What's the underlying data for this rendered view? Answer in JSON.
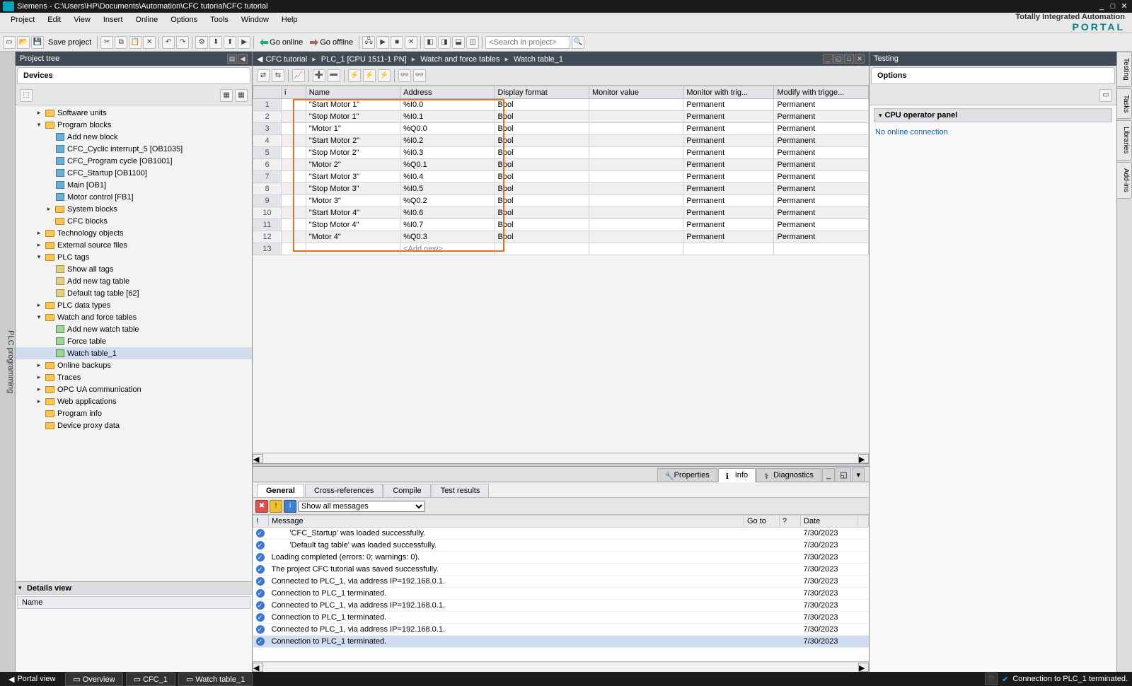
{
  "title": "Siemens  -  C:\\Users\\HP\\Documents\\Automation\\CFC tutorial\\CFC tutorial",
  "brand_line1": "Totally Integrated Automation",
  "brand_line2": "PORTAL",
  "mainmenu": [
    "Project",
    "Edit",
    "View",
    "Insert",
    "Online",
    "Options",
    "Tools",
    "Window",
    "Help"
  ],
  "toolbar": {
    "save_label": "Save project",
    "go_online": "Go online",
    "go_offline": "Go offline",
    "search_placeholder": "<Search in project>"
  },
  "left_strip": "PLC programming",
  "project_tree": {
    "title": "Project tree",
    "devices_tab": "Devices",
    "nodes": [
      {
        "depth": 2,
        "exp": ">",
        "icon": "folder",
        "label": "Software units"
      },
      {
        "depth": 2,
        "exp": "v",
        "icon": "folder",
        "label": "Program blocks"
      },
      {
        "depth": 3,
        "exp": "",
        "icon": "block",
        "label": "Add new block"
      },
      {
        "depth": 3,
        "exp": "",
        "icon": "block",
        "label": "CFC_Cyclic interrupt_5 [OB1035]"
      },
      {
        "depth": 3,
        "exp": "",
        "icon": "block",
        "label": "CFC_Program cycle [OB1001]"
      },
      {
        "depth": 3,
        "exp": "",
        "icon": "block",
        "label": "CFC_Startup [OB1100]"
      },
      {
        "depth": 3,
        "exp": "",
        "icon": "block",
        "label": "Main [OB1]"
      },
      {
        "depth": 3,
        "exp": "",
        "icon": "block",
        "label": "Motor control [FB1]"
      },
      {
        "depth": 3,
        "exp": ">",
        "icon": "folder",
        "label": "System blocks"
      },
      {
        "depth": 3,
        "exp": "",
        "icon": "folder",
        "label": "CFC blocks"
      },
      {
        "depth": 2,
        "exp": ">",
        "icon": "folder",
        "label": "Technology objects"
      },
      {
        "depth": 2,
        "exp": ">",
        "icon": "folder",
        "label": "External source files"
      },
      {
        "depth": 2,
        "exp": "v",
        "icon": "folder",
        "label": "PLC tags"
      },
      {
        "depth": 3,
        "exp": "",
        "icon": "tag",
        "label": "Show all tags"
      },
      {
        "depth": 3,
        "exp": "",
        "icon": "tag",
        "label": "Add new tag table"
      },
      {
        "depth": 3,
        "exp": "",
        "icon": "tag",
        "label": "Default tag table [62]"
      },
      {
        "depth": 2,
        "exp": ">",
        "icon": "folder",
        "label": "PLC data types"
      },
      {
        "depth": 2,
        "exp": "v",
        "icon": "folder",
        "label": "Watch and force tables"
      },
      {
        "depth": 3,
        "exp": "",
        "icon": "table",
        "label": "Add new watch table"
      },
      {
        "depth": 3,
        "exp": "",
        "icon": "table",
        "label": "Force table"
      },
      {
        "depth": 3,
        "exp": "",
        "icon": "table",
        "label": "Watch table_1",
        "selected": true
      },
      {
        "depth": 2,
        "exp": ">",
        "icon": "folder",
        "label": "Online backups"
      },
      {
        "depth": 2,
        "exp": ">",
        "icon": "folder",
        "label": "Traces"
      },
      {
        "depth": 2,
        "exp": ">",
        "icon": "folder",
        "label": "OPC UA communication"
      },
      {
        "depth": 2,
        "exp": ">",
        "icon": "folder",
        "label": "Web applications"
      },
      {
        "depth": 2,
        "exp": "",
        "icon": "folder",
        "label": "Program info"
      },
      {
        "depth": 2,
        "exp": "",
        "icon": "folder",
        "label": "Device proxy data"
      }
    ],
    "details_title": "Details view",
    "details_col": "Name"
  },
  "center": {
    "breadcrumb": [
      "CFC tutorial",
      "PLC_1 [CPU 1511-1 PN]",
      "Watch and force tables",
      "Watch table_1"
    ],
    "cols": [
      "i",
      "Name",
      "Address",
      "Display format",
      "Monitor value",
      "Monitor with trig...",
      "Modify with trigge..."
    ],
    "rows": [
      {
        "n": "1",
        "name": "\"Start Motor 1\"",
        "addr": "%I0.0",
        "fmt": "Bool",
        "mon": "",
        "trig": "Permanent",
        "mod": "Permanent"
      },
      {
        "n": "2",
        "name": "\"Stop Motor 1\"",
        "addr": "%I0.1",
        "fmt": "Bool",
        "mon": "",
        "trig": "Permanent",
        "mod": "Permanent"
      },
      {
        "n": "3",
        "name": "\"Motor 1\"",
        "addr": "%Q0.0",
        "fmt": "Bool",
        "mon": "",
        "trig": "Permanent",
        "mod": "Permanent"
      },
      {
        "n": "4",
        "name": "\"Start Motor 2\"",
        "addr": "%I0.2",
        "fmt": "Bool",
        "mon": "",
        "trig": "Permanent",
        "mod": "Permanent"
      },
      {
        "n": "5",
        "name": "\"Stop Motor 2\"",
        "addr": "%I0.3",
        "fmt": "Bool",
        "mon": "",
        "trig": "Permanent",
        "mod": "Permanent"
      },
      {
        "n": "6",
        "name": "\"Motor 2\"",
        "addr": "%Q0.1",
        "fmt": "Bool",
        "mon": "",
        "trig": "Permanent",
        "mod": "Permanent"
      },
      {
        "n": "7",
        "name": "\"Start Motor 3\"",
        "addr": "%I0.4",
        "fmt": "Bool",
        "mon": "",
        "trig": "Permanent",
        "mod": "Permanent"
      },
      {
        "n": "8",
        "name": "\"Stop Motor 3\"",
        "addr": "%I0.5",
        "fmt": "Bool",
        "mon": "",
        "trig": "Permanent",
        "mod": "Permanent"
      },
      {
        "n": "9",
        "name": "\"Motor 3\"",
        "addr": "%Q0.2",
        "fmt": "Bool",
        "mon": "",
        "trig": "Permanent",
        "mod": "Permanent"
      },
      {
        "n": "10",
        "name": "\"Start Motor 4\"",
        "addr": "%I0.6",
        "fmt": "Bool",
        "mon": "",
        "trig": "Permanent",
        "mod": "Permanent"
      },
      {
        "n": "11",
        "name": "\"Stop Motor 4\"",
        "addr": "%I0.7",
        "fmt": "Bool",
        "mon": "",
        "trig": "Permanent",
        "mod": "Permanent"
      },
      {
        "n": "12",
        "name": "\"Motor 4\"",
        "addr": "%Q0.3",
        "fmt": "Bool",
        "mon": "",
        "trig": "Permanent",
        "mod": "Permanent"
      }
    ],
    "add_new": "<Add new>",
    "add_row_num": "13"
  },
  "info": {
    "top_tabs": [
      {
        "label": "Properties",
        "icon": "props"
      },
      {
        "label": "Info",
        "icon": "info",
        "active": true
      },
      {
        "label": "Diagnostics",
        "icon": "diag"
      }
    ],
    "sub_tabs": [
      "General",
      "Cross-references",
      "Compile",
      "Test results"
    ],
    "active_sub": "General",
    "filter": "Show all messages",
    "cols": [
      "!",
      "Message",
      "Go to",
      "?",
      "Date"
    ],
    "messages": [
      {
        "msg": "'CFC_Startup' was loaded successfully.",
        "date": "7/30/2023",
        "indent": 1
      },
      {
        "msg": "'Default tag table' was loaded successfully.",
        "date": "7/30/2023",
        "indent": 1
      },
      {
        "msg": "Loading completed (errors: 0; warnings: 0).",
        "date": "7/30/2023"
      },
      {
        "msg": "The project CFC tutorial was saved successfully.",
        "date": "7/30/2023"
      },
      {
        "msg": "Connected to PLC_1, via address IP=192.168.0.1.",
        "date": "7/30/2023"
      },
      {
        "msg": "Connection to PLC_1 terminated.",
        "date": "7/30/2023"
      },
      {
        "msg": "Connected to PLC_1, via address IP=192.168.0.1.",
        "date": "7/30/2023"
      },
      {
        "msg": "Connection to PLC_1 terminated.",
        "date": "7/30/2023"
      },
      {
        "msg": "Connected to PLC_1, via address IP=192.168.0.1.",
        "date": "7/30/2023"
      },
      {
        "msg": "Connection to PLC_1 terminated.",
        "date": "7/30/2023",
        "sel": true
      }
    ]
  },
  "right": {
    "title": "Testing",
    "options": "Options",
    "section": "CPU operator panel",
    "msg": "No online connection",
    "side_tabs": [
      "Testing",
      "Tasks",
      "Libraries",
      "Add-ins"
    ]
  },
  "status": {
    "portal_view": "Portal view",
    "tabs": [
      "Overview",
      "CFC_1",
      "Watch table_1"
    ],
    "conn": "Connection to PLC_1 terminated."
  }
}
